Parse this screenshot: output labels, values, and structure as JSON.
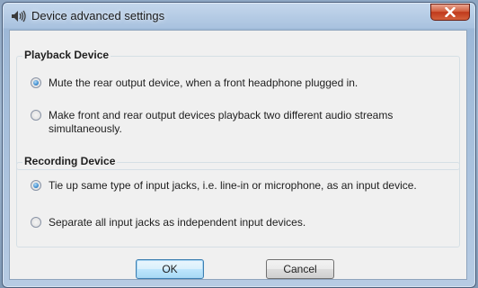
{
  "window": {
    "title": "Device advanced settings",
    "title_icon": "speaker-icon",
    "close_icon": "close-icon"
  },
  "playback": {
    "heading": "Playback Device",
    "options": [
      {
        "label": "Mute the rear output device, when a front headphone plugged in.",
        "checked": true
      },
      {
        "label": "Make front and rear output devices playback two different audio streams simultaneously.",
        "checked": false
      }
    ]
  },
  "recording": {
    "heading": "Recording Device",
    "options": [
      {
        "label": "Tie up same type of input jacks, i.e. line-in or microphone, as an input device.",
        "checked": true
      },
      {
        "label": "Separate all input jacks as independent input devices.",
        "checked": false
      }
    ]
  },
  "buttons": {
    "ok": "OK",
    "cancel": "Cancel"
  },
  "colors": {
    "accent": "#3c7fb1",
    "close": "#c0391b"
  }
}
